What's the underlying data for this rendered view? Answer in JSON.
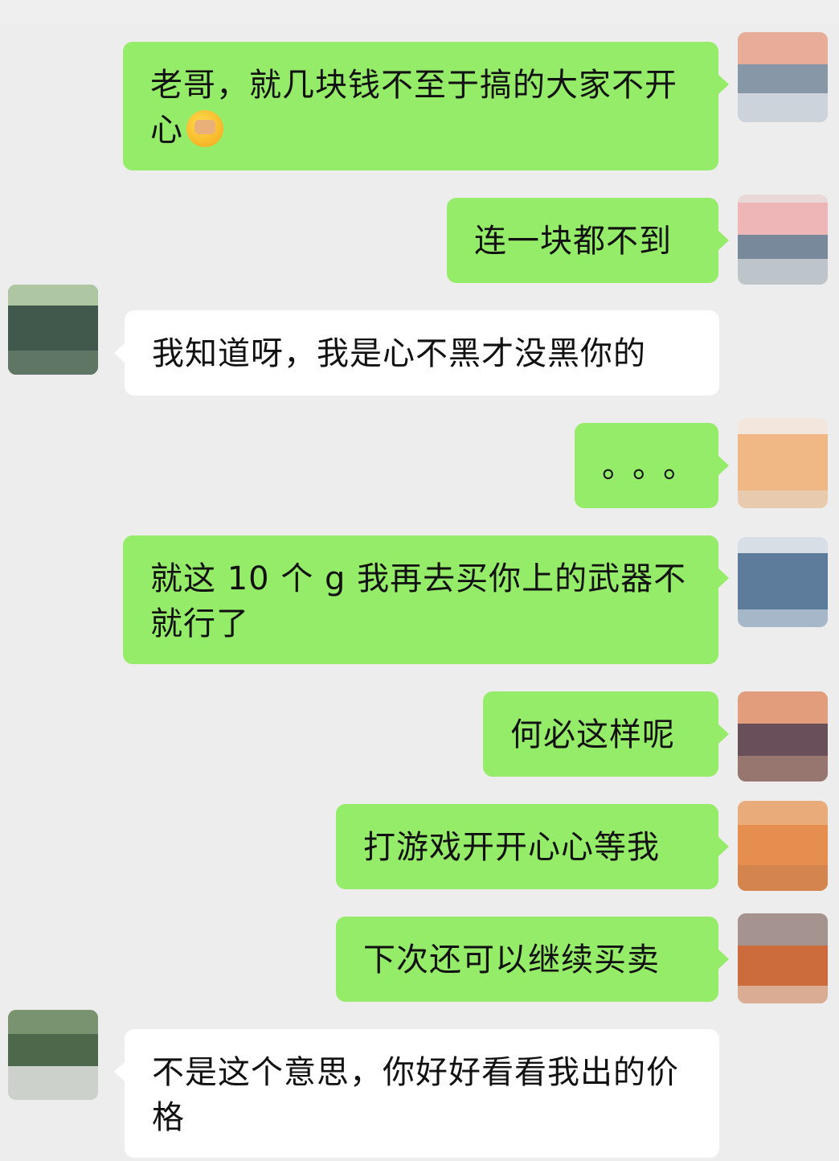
{
  "messages": [
    {
      "side": "out",
      "text": "老哥，就几块钱不至于搞的大家不开心",
      "emoji": "face-palm-emoji"
    },
    {
      "side": "out",
      "text": "连一块都不到"
    },
    {
      "side": "in",
      "text": "我知道呀，我是心不黑才没黑你的"
    },
    {
      "side": "out",
      "text": "。。。"
    },
    {
      "side": "out",
      "text": "就这 10 个 g 我再去买你上的武器不就行了"
    },
    {
      "side": "out",
      "text": "何必这样呢"
    },
    {
      "side": "out",
      "text": "打游戏开开心心等我"
    },
    {
      "side": "out",
      "text": "下次还可以继续买卖"
    },
    {
      "side": "in",
      "text": "不是这个意思，你好好看看我出的价格"
    }
  ],
  "colors": {
    "background": "#ededed",
    "outgoing_bubble": "#95ec69",
    "incoming_bubble": "#ffffff",
    "text": "#111111"
  },
  "avatars": {
    "self": "blurred-avatar-warm",
    "other": "blurred-avatar-green"
  }
}
